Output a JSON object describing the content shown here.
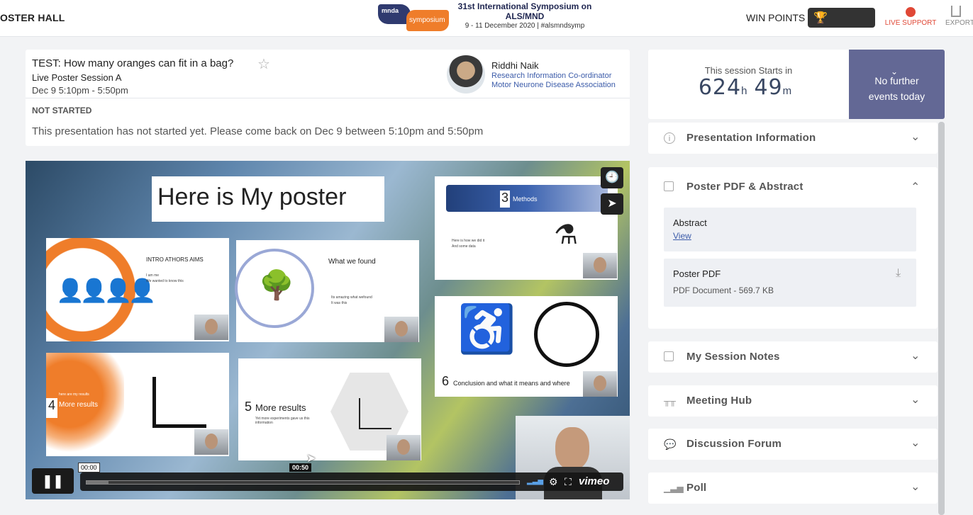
{
  "header": {
    "poster_hall": "OSTER HALL",
    "logo_small": "mnda",
    "logo_orange": "symposium",
    "symposium_title": "31st International Symposium on ALS/MND",
    "symposium_dates": "9 - 11 December 2020  |  #alsmndsymp",
    "win_points": "WIN POINTS",
    "live_support": "LIVE SUPPORT",
    "export": "EXPORT"
  },
  "session": {
    "title": "TEST: How many oranges can fit in a bag?",
    "subtitle": "Live Poster Session A",
    "time": "Dec 9 5:10pm - 5:50pm",
    "speaker_name": "Riddhi Naik",
    "speaker_role_1": "Research Information Co-ordinator",
    "speaker_role_2": "Motor Neurone Disease Association",
    "status": "NOT STARTED",
    "status_message": "This presentation has not started yet. Please come back on Dec 9 between 5:10pm and 5:50pm"
  },
  "video": {
    "poster_title": "Here is My poster",
    "slides": {
      "intro": "INTRO ATHORS AIMS",
      "intro_b1": "I am me",
      "intro_b2": "We wanted to know this",
      "found": "What we found",
      "found_b1": "Its amazing what wefound",
      "found_b2": "It was this",
      "methods_num": "3",
      "methods": "Methods",
      "methods_b1": "Here is how we did it",
      "methods_b2": "And some data",
      "results_num": "4",
      "results": "More results",
      "results_small": "here are my results",
      "more_num": "5",
      "more": "More results",
      "more_b1": "Yet more experiments gave us this information",
      "concl_num": "6",
      "concl": "Conclusion and what it means and where"
    },
    "current_time": "00:00",
    "hover_time": "00:50",
    "progress": 0.05,
    "brand": "vimeo"
  },
  "countdown": {
    "label": "This session Starts in",
    "hours": "624",
    "hours_unit": "h",
    "minutes": "49",
    "minutes_unit": "m"
  },
  "no_events": "No further events today",
  "accordion": {
    "presentation_info": "Presentation Information",
    "poster_pdf": "Poster PDF & Abstract",
    "abstract_title": "Abstract",
    "abstract_link": "View",
    "pdf_title": "Poster PDF",
    "pdf_meta": "PDF Document - 569.7 KB",
    "session_notes": "My Session Notes",
    "meeting_hub": "Meeting Hub",
    "discussion_forum": "Discussion Forum",
    "poll": "Poll"
  }
}
